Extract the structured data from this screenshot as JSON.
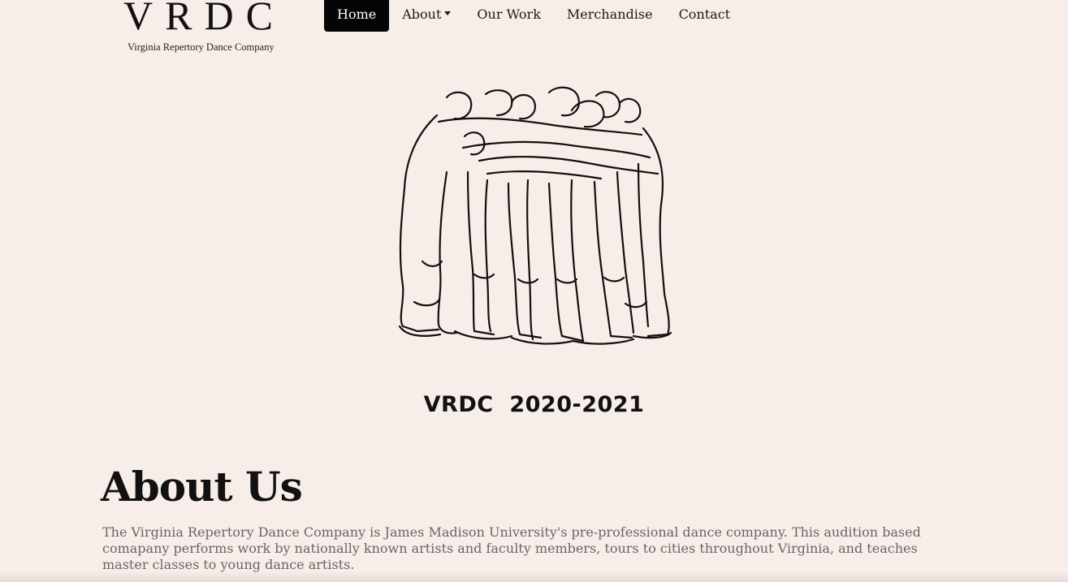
{
  "logo": {
    "mark": "VRDC",
    "subtitle": "Virginia Repertory Dance Company"
  },
  "nav": {
    "items": [
      {
        "label": "Home"
      },
      {
        "label": "About"
      },
      {
        "label": "Our Work"
      },
      {
        "label": "Merchandise"
      },
      {
        "label": "Contact"
      }
    ],
    "active_color": "#050505"
  },
  "hero": {
    "caption": "VRDC  2020-2021"
  },
  "about": {
    "title": "About Us",
    "body": "The Virginia Repertory Dance Company is James Madison University's pre-professional dance company. This audition based comapany performs work by nationally known artists and faculty members, tours to cities throughout Virginia, and teaches master classes to young dance artists."
  },
  "colors": {
    "background": "#f7eee9",
    "text": "#111111",
    "body_text": "#666666"
  }
}
